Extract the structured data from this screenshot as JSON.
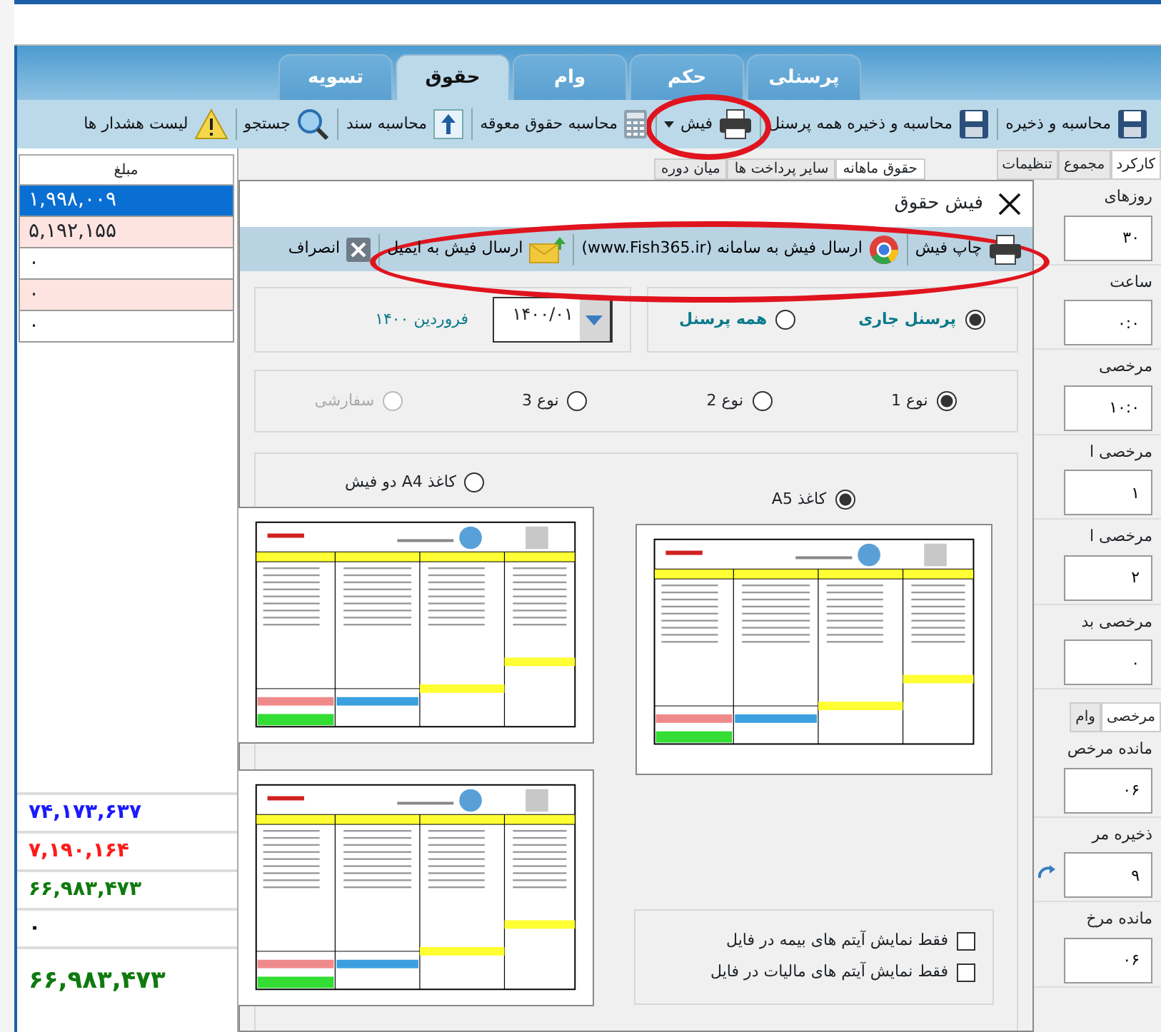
{
  "main_tabs": [
    {
      "label": "پرسنلی",
      "selected": false
    },
    {
      "label": "حکم",
      "selected": false
    },
    {
      "label": "وام",
      "selected": false
    },
    {
      "label": "حقوق",
      "selected": true
    },
    {
      "label": "تسویه",
      "selected": false
    }
  ],
  "toolbar": [
    {
      "label": "محاسبه و ذخیره",
      "dropdown": false,
      "highlighted": false
    },
    {
      "label": "محاسبه و ذخیره همه پرسنل",
      "dropdown": false,
      "highlighted": false
    },
    {
      "label": "فیش",
      "dropdown": true,
      "highlighted": true
    },
    {
      "label": "محاسبه حقوق معوقه",
      "dropdown": false,
      "highlighted": false
    },
    {
      "label": "محاسبه سند",
      "dropdown": false,
      "highlighted": false
    },
    {
      "label": "جستجو",
      "dropdown": false,
      "highlighted": false
    },
    {
      "label": "لیست هشدار ها",
      "dropdown": false,
      "highlighted": false
    }
  ],
  "side_panel": {
    "tabs": [
      {
        "label": "کارکرد",
        "selected": true
      },
      {
        "label": "مجموع",
        "selected": false
      },
      {
        "label": "تنظیمات",
        "selected": false
      }
    ],
    "fields": [
      {
        "label": "روزهای",
        "value": "۳۰"
      },
      {
        "label": "ساعت",
        "value": "۰:۰"
      },
      {
        "label": "مرخصی",
        "value": "۱۰:۰"
      },
      {
        "label": "مرخصی ا",
        "value": "۱"
      },
      {
        "label": "مرخصی ا",
        "value": "۲"
      },
      {
        "label": "مرخصی بد",
        "value": "۰"
      }
    ],
    "lower_tabs": [
      {
        "label": "مرخصی",
        "selected": true
      },
      {
        "label": "وام",
        "selected": false
      }
    ],
    "lower_fields": [
      {
        "label": "مانده مرخص",
        "value": "۰۶",
        "refresh": false
      },
      {
        "label": "ذخیره مر",
        "value": "۹",
        "refresh": true
      },
      {
        "label": "مانده مرخ",
        "value": "۰۶",
        "refresh": false
      }
    ]
  },
  "sub_tabs": [
    {
      "label": "حقوق ماهانه",
      "selected": true
    },
    {
      "label": "سایر پرداخت ها",
      "selected": false
    },
    {
      "label": "میان دوره",
      "selected": false
    }
  ],
  "amount_table": {
    "columns": [
      "مبلغ"
    ],
    "rows": [
      {
        "value": "۱,۹۹۸,۰۰۹",
        "selected": true
      },
      {
        "value": "۵,۱۹۲,۱۵۵",
        "selected": false,
        "color": "#fde4e1"
      },
      {
        "value": "۰",
        "selected": false,
        "color": "#ffffff"
      },
      {
        "value": "۰",
        "selected": false,
        "color": "#fde4e1"
      },
      {
        "value": "۰",
        "selected": false,
        "color": "#ffffff"
      }
    ],
    "totals": [
      {
        "value": "۷۴,۱۷۳,۶۳۷",
        "color": "#1a1aff",
        "kind": "sum"
      },
      {
        "value": "۷,۱۹۰,۱۶۴",
        "color": "#ff1a1a",
        "kind": "sum"
      },
      {
        "value": "۶۶,۹۸۳,۴۷۳",
        "color": "#0f7a0f",
        "kind": "sum"
      },
      {
        "value": "۰",
        "color": "#000000",
        "kind": "sum"
      },
      {
        "value": "۶۶,۹۸۳,۴۷۳",
        "color": "#0f7a0f",
        "kind": "grand"
      }
    ]
  },
  "dialog": {
    "title": "فیش حقوق",
    "actions_highlighted": true,
    "actions": [
      {
        "label": "چاپ فیش"
      },
      {
        "label": "ارسال فیش به سامانه (www.Fish365.ir)"
      },
      {
        "label": "ارسال فیش به ایمیل"
      },
      {
        "label": "انصراف"
      }
    ],
    "recipients": [
      {
        "label": "پرسنل جاری",
        "selected": true
      },
      {
        "label": "همه پرسنل",
        "selected": false
      }
    ],
    "period": {
      "value": "۱۴۰۰/۰۱",
      "caption": "فروردین ۱۴۰۰"
    },
    "templates": [
      {
        "label": "نوع 1",
        "selected": true,
        "disabled": false
      },
      {
        "label": "نوع 2",
        "selected": false,
        "disabled": false
      },
      {
        "label": "نوع 3",
        "selected": false,
        "disabled": false
      },
      {
        "label": "سفارشی",
        "selected": false,
        "disabled": true
      }
    ],
    "paper": [
      {
        "label": "کاغذ A5",
        "selected": true
      },
      {
        "label": "کاغذ A4  دو فیش",
        "selected": false
      }
    ],
    "options": [
      {
        "label": "فقط نمایش آیتم های بیمه در فایل",
        "checked": false
      },
      {
        "label": "فقط نمایش آیتم های مالیات در فایل",
        "checked": false
      }
    ]
  }
}
